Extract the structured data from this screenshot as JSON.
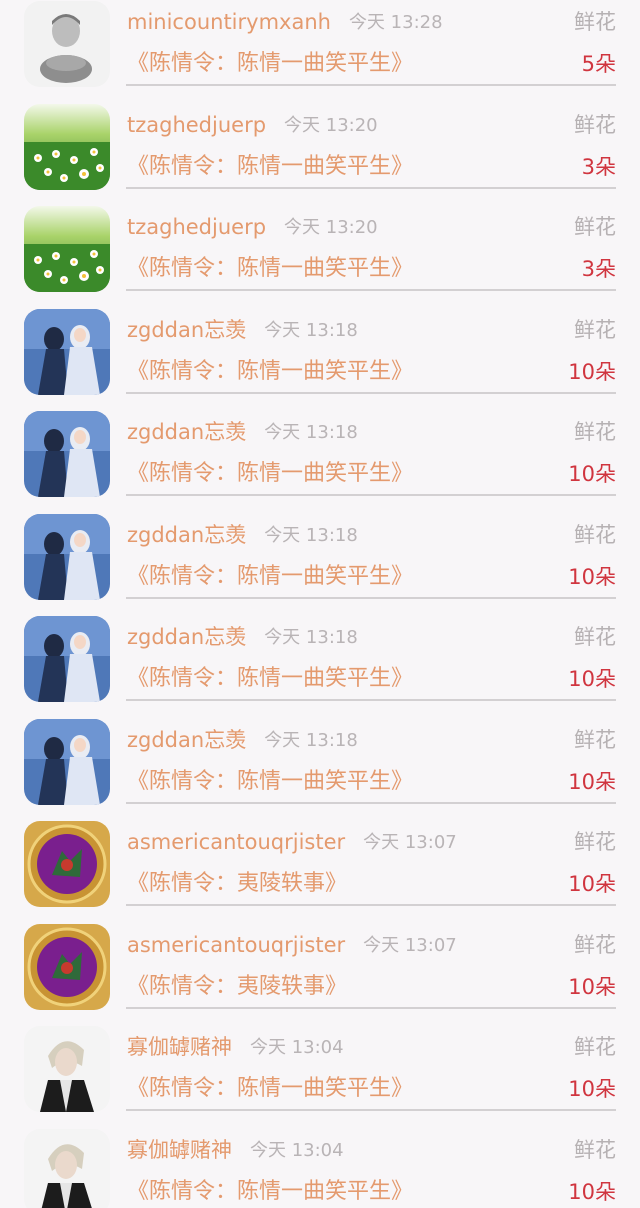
{
  "rows": [
    {
      "username": "minicountirymxanh",
      "time": "今天 13:28",
      "gift": "鲜花",
      "drama": "《陈情令：陈情一曲笑平生》",
      "count": "5朵",
      "avatar": "avatar-person-bw"
    },
    {
      "username": "tzaghedjuerp",
      "time": "今天 13:20",
      "gift": "鲜花",
      "drama": "《陈情令：陈情一曲笑平生》",
      "count": "3朵",
      "avatar": "avatar-daisy-field"
    },
    {
      "username": "tzaghedjuerp",
      "time": "今天 13:20",
      "gift": "鲜花",
      "drama": "《陈情令：陈情一曲笑平生》",
      "count": "3朵",
      "avatar": "avatar-daisy-field"
    },
    {
      "username": "zgddan忘羡",
      "time": "今天 13:18",
      "gift": "鲜花",
      "drama": "《陈情令：陈情一曲笑平生》",
      "count": "10朵",
      "avatar": "avatar-couple-blue"
    },
    {
      "username": "zgddan忘羡",
      "time": "今天 13:18",
      "gift": "鲜花",
      "drama": "《陈情令：陈情一曲笑平生》",
      "count": "10朵",
      "avatar": "avatar-couple-blue"
    },
    {
      "username": "zgddan忘羡",
      "time": "今天 13:18",
      "gift": "鲜花",
      "drama": "《陈情令：陈情一曲笑平生》",
      "count": "10朵",
      "avatar": "avatar-couple-blue"
    },
    {
      "username": "zgddan忘羡",
      "time": "今天 13:18",
      "gift": "鲜花",
      "drama": "《陈情令：陈情一曲笑平生》",
      "count": "10朵",
      "avatar": "avatar-couple-blue"
    },
    {
      "username": "zgddan忘羡",
      "time": "今天 13:18",
      "gift": "鲜花",
      "drama": "《陈情令：陈情一曲笑平生》",
      "count": "10朵",
      "avatar": "avatar-couple-blue"
    },
    {
      "username": "asmericantouqrjister",
      "time": "今天 13:07",
      "gift": "鲜花",
      "drama": "《陈情令：夷陵轶事》",
      "count": "10朵",
      "avatar": "avatar-gold-emblem"
    },
    {
      "username": "asmericantouqrjister",
      "time": "今天 13:07",
      "gift": "鲜花",
      "drama": "《陈情令：夷陵轶事》",
      "count": "10朵",
      "avatar": "avatar-gold-emblem"
    },
    {
      "username": "寡伽罅赌神",
      "time": "今天 13:04",
      "gift": "鲜花",
      "drama": "《陈情令：陈情一曲笑平生》",
      "count": "10朵",
      "avatar": "avatar-person-blond"
    },
    {
      "username": "寡伽罅赌神",
      "time": "今天 13:04",
      "gift": "鲜花",
      "drama": "《陈情令：陈情一曲笑平生》",
      "count": "10朵",
      "avatar": "avatar-person-blond"
    }
  ]
}
